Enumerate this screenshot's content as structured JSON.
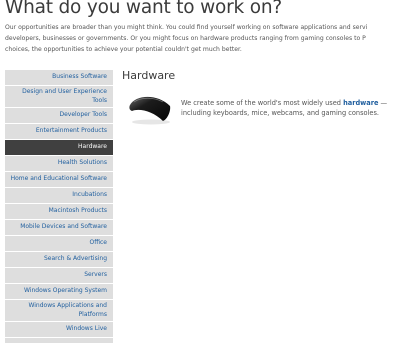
{
  "header": {
    "title": "What do you want to work on?"
  },
  "intro": {
    "line1": "Our opportunities are broader than you might think. You could find yourself working on software applications and servi",
    "line2": "developers, businesses or governments. Or you might focus on hardware products ranging from gaming consoles to P",
    "line3": "choices, the opportunities to achieve your potential couldn't get much better."
  },
  "sidebar": {
    "items": [
      {
        "label": "Business Software"
      },
      {
        "label": "Design and User Experience Tools"
      },
      {
        "label": "Developer Tools"
      },
      {
        "label": "Entertainment Products"
      },
      {
        "label": "Hardware",
        "active": true
      },
      {
        "label": "Health Solutions"
      },
      {
        "label": "Home and Educational Software"
      },
      {
        "label": "Incubations"
      },
      {
        "label": "Macintosh Products"
      },
      {
        "label": "Mobile Devices and Software"
      },
      {
        "label": "Office"
      },
      {
        "label": "Search & Advertising"
      },
      {
        "label": "Servers"
      },
      {
        "label": "Windows Operating System"
      },
      {
        "label": "Windows Applications and Platforms"
      },
      {
        "label": "Windows Live"
      }
    ]
  },
  "main": {
    "section_title": "Hardware",
    "description_before": "We create some of the world's most widely used ",
    "description_link": "hardware",
    "description_after": " — including keyboards, mice, webcams, and gaming consoles.",
    "image_icon": "arc-mouse-image"
  },
  "colors": {
    "link": "#1f5e9e",
    "sidebar_bg": "#dedede",
    "active_bg": "#404040"
  }
}
